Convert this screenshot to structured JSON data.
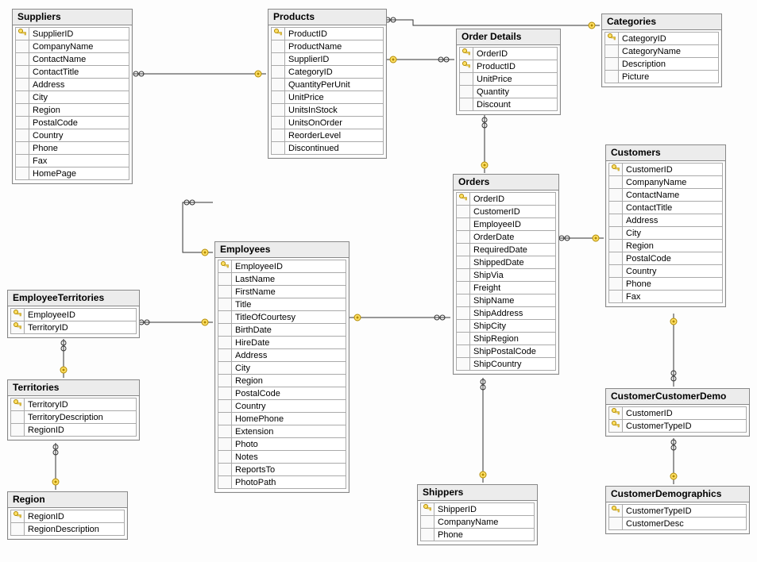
{
  "keyGlyph": "🔑",
  "tables": {
    "suppliers": {
      "title": "Suppliers",
      "fields": [
        {
          "name": "SupplierID",
          "pk": true
        },
        {
          "name": "CompanyName",
          "pk": false
        },
        {
          "name": "ContactName",
          "pk": false
        },
        {
          "name": "ContactTitle",
          "pk": false
        },
        {
          "name": "Address",
          "pk": false
        },
        {
          "name": "City",
          "pk": false
        },
        {
          "name": "Region",
          "pk": false
        },
        {
          "name": "PostalCode",
          "pk": false
        },
        {
          "name": "Country",
          "pk": false
        },
        {
          "name": "Phone",
          "pk": false
        },
        {
          "name": "Fax",
          "pk": false
        },
        {
          "name": "HomePage",
          "pk": false
        }
      ]
    },
    "products": {
      "title": "Products",
      "fields": [
        {
          "name": "ProductID",
          "pk": true
        },
        {
          "name": "ProductName",
          "pk": false
        },
        {
          "name": "SupplierID",
          "pk": false
        },
        {
          "name": "CategoryID",
          "pk": false
        },
        {
          "name": "QuantityPerUnit",
          "pk": false
        },
        {
          "name": "UnitPrice",
          "pk": false
        },
        {
          "name": "UnitsInStock",
          "pk": false
        },
        {
          "name": "UnitsOnOrder",
          "pk": false
        },
        {
          "name": "ReorderLevel",
          "pk": false
        },
        {
          "name": "Discontinued",
          "pk": false
        }
      ]
    },
    "categories": {
      "title": "Categories",
      "fields": [
        {
          "name": "CategoryID",
          "pk": true
        },
        {
          "name": "CategoryName",
          "pk": false
        },
        {
          "name": "Description",
          "pk": false
        },
        {
          "name": "Picture",
          "pk": false
        }
      ]
    },
    "orderDetails": {
      "title": "Order Details",
      "fields": [
        {
          "name": "OrderID",
          "pk": true
        },
        {
          "name": "ProductID",
          "pk": true
        },
        {
          "name": "UnitPrice",
          "pk": false
        },
        {
          "name": "Quantity",
          "pk": false
        },
        {
          "name": "Discount",
          "pk": false
        }
      ]
    },
    "orders": {
      "title": "Orders",
      "fields": [
        {
          "name": "OrderID",
          "pk": true
        },
        {
          "name": "CustomerID",
          "pk": false
        },
        {
          "name": "EmployeeID",
          "pk": false
        },
        {
          "name": "OrderDate",
          "pk": false
        },
        {
          "name": "RequiredDate",
          "pk": false
        },
        {
          "name": "ShippedDate",
          "pk": false
        },
        {
          "name": "ShipVia",
          "pk": false
        },
        {
          "name": "Freight",
          "pk": false
        },
        {
          "name": "ShipName",
          "pk": false
        },
        {
          "name": "ShipAddress",
          "pk": false
        },
        {
          "name": "ShipCity",
          "pk": false
        },
        {
          "name": "ShipRegion",
          "pk": false
        },
        {
          "name": "ShipPostalCode",
          "pk": false
        },
        {
          "name": "ShipCountry",
          "pk": false
        }
      ]
    },
    "customers": {
      "title": "Customers",
      "fields": [
        {
          "name": "CustomerID",
          "pk": true
        },
        {
          "name": "CompanyName",
          "pk": false
        },
        {
          "name": "ContactName",
          "pk": false
        },
        {
          "name": "ContactTitle",
          "pk": false
        },
        {
          "name": "Address",
          "pk": false
        },
        {
          "name": "City",
          "pk": false
        },
        {
          "name": "Region",
          "pk": false
        },
        {
          "name": "PostalCode",
          "pk": false
        },
        {
          "name": "Country",
          "pk": false
        },
        {
          "name": "Phone",
          "pk": false
        },
        {
          "name": "Fax",
          "pk": false
        }
      ]
    },
    "customerCustomerDemo": {
      "title": "CustomerCustomerDemo",
      "fields": [
        {
          "name": "CustomerID",
          "pk": true
        },
        {
          "name": "CustomerTypeID",
          "pk": true
        }
      ]
    },
    "customerDemographics": {
      "title": "CustomerDemographics",
      "fields": [
        {
          "name": "CustomerTypeID",
          "pk": true
        },
        {
          "name": "CustomerDesc",
          "pk": false
        }
      ]
    },
    "shippers": {
      "title": "Shippers",
      "fields": [
        {
          "name": "ShipperID",
          "pk": true
        },
        {
          "name": "CompanyName",
          "pk": false
        },
        {
          "name": "Phone",
          "pk": false
        }
      ]
    },
    "employees": {
      "title": "Employees",
      "fields": [
        {
          "name": "EmployeeID",
          "pk": true
        },
        {
          "name": "LastName",
          "pk": false
        },
        {
          "name": "FirstName",
          "pk": false
        },
        {
          "name": "Title",
          "pk": false
        },
        {
          "name": "TitleOfCourtesy",
          "pk": false
        },
        {
          "name": "BirthDate",
          "pk": false
        },
        {
          "name": "HireDate",
          "pk": false
        },
        {
          "name": "Address",
          "pk": false
        },
        {
          "name": "City",
          "pk": false
        },
        {
          "name": "Region",
          "pk": false
        },
        {
          "name": "PostalCode",
          "pk": false
        },
        {
          "name": "Country",
          "pk": false
        },
        {
          "name": "HomePhone",
          "pk": false
        },
        {
          "name": "Extension",
          "pk": false
        },
        {
          "name": "Photo",
          "pk": false
        },
        {
          "name": "Notes",
          "pk": false
        },
        {
          "name": "ReportsTo",
          "pk": false
        },
        {
          "name": "PhotoPath",
          "pk": false
        }
      ]
    },
    "employeeTerritories": {
      "title": "EmployeeTerritories",
      "fields": [
        {
          "name": "EmployeeID",
          "pk": true
        },
        {
          "name": "TerritoryID",
          "pk": true
        }
      ]
    },
    "territories": {
      "title": "Territories",
      "fields": [
        {
          "name": "TerritoryID",
          "pk": true
        },
        {
          "name": "TerritoryDescription",
          "pk": false
        },
        {
          "name": "RegionID",
          "pk": false
        }
      ]
    },
    "region": {
      "title": "Region",
      "fields": [
        {
          "name": "RegionID",
          "pk": true
        },
        {
          "name": "RegionDescription",
          "pk": false
        }
      ]
    }
  },
  "relations": [
    {
      "from": "suppliers",
      "to": "products"
    },
    {
      "from": "products",
      "to": "categories"
    },
    {
      "from": "products",
      "to": "orderDetails"
    },
    {
      "from": "orderDetails",
      "to": "orders"
    },
    {
      "from": "orders",
      "to": "customers"
    },
    {
      "from": "orders",
      "to": "shippers"
    },
    {
      "from": "orders",
      "to": "employees"
    },
    {
      "from": "employees",
      "to": "employees"
    },
    {
      "from": "employees",
      "to": "employeeTerritories"
    },
    {
      "from": "employeeTerritories",
      "to": "territories"
    },
    {
      "from": "territories",
      "to": "region"
    },
    {
      "from": "customers",
      "to": "customerCustomerDemo"
    },
    {
      "from": "customerCustomerDemo",
      "to": "customerDemographics"
    }
  ]
}
